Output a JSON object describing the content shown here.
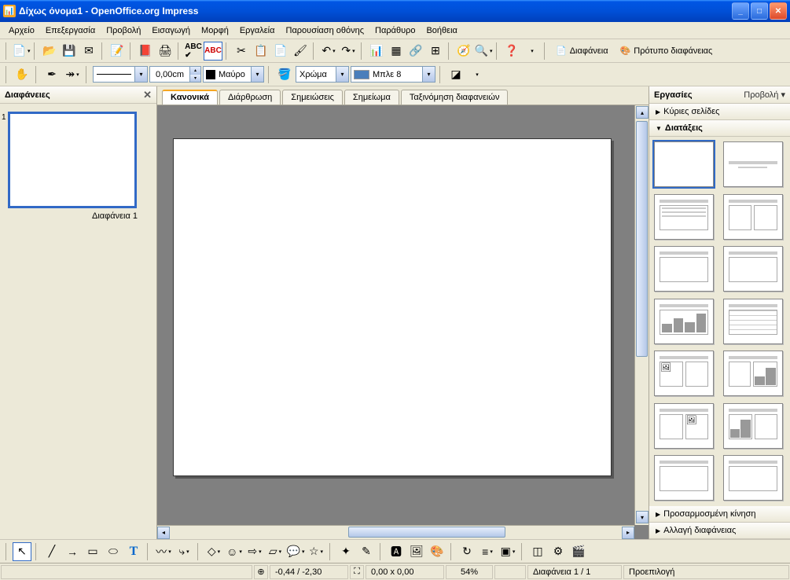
{
  "window": {
    "title": "Δίχως όνομα1 - OpenOffice.org Impress"
  },
  "menubar": [
    "Αρχείο",
    "Επεξεργασία",
    "Προβολή",
    "Εισαγωγή",
    "Μορφή",
    "Εργαλεία",
    "Παρουσίαση οθόνης",
    "Παράθυρο",
    "Βοήθεια"
  ],
  "toolbar1": {
    "slide_button": "Διαφάνεια",
    "slide_template_button": "Πρότυπο διαφάνειας"
  },
  "toolbar2": {
    "line_width": "0,00cm",
    "line_color": "Μαύρο",
    "fill_label": "Χρώμα",
    "fill_color": "Μπλε 8"
  },
  "slides_panel": {
    "title": "Διαφάνειες",
    "slide_number": "1",
    "slide_label": "Διαφάνεια 1"
  },
  "view_tabs": [
    "Κανονικά",
    "Διάρθρωση",
    "Σημειώσεις",
    "Σημείωμα",
    "Ταξινόμηση διαφανειών"
  ],
  "tasks_panel": {
    "title": "Εργασίες",
    "view_link": "Προβολή",
    "sections": {
      "master_pages": "Κύριες σελίδες",
      "layouts": "Διατάξεις",
      "custom_animation": "Προσαρμοσμένη κίνηση",
      "slide_transition": "Αλλαγή διαφάνειας"
    }
  },
  "statusbar": {
    "position": "-0,44 / -2,30",
    "size": "0,00 x 0,00",
    "zoom": "54%",
    "slide_count": "Διαφάνεια 1 / 1",
    "default": "Προεπιλογή"
  }
}
